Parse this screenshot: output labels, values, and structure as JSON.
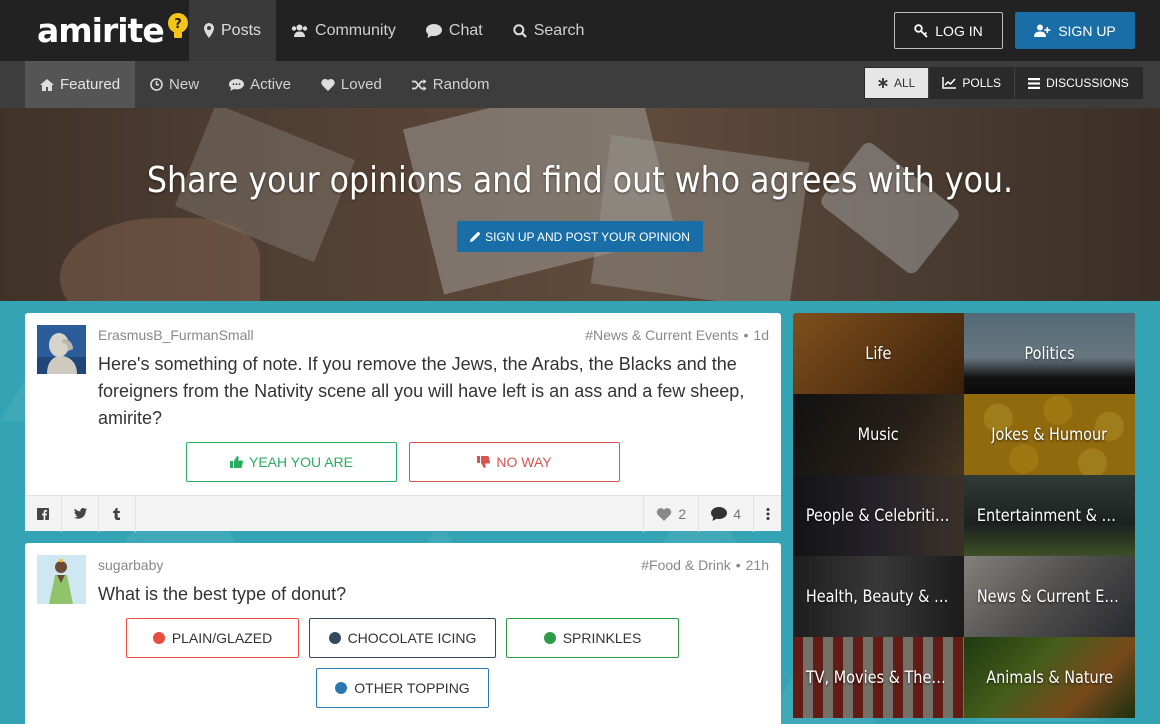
{
  "brand": {
    "name": "amirite"
  },
  "topnav": {
    "items": [
      {
        "label": "Posts",
        "icon": "map-marker-icon",
        "active": true
      },
      {
        "label": "Community",
        "icon": "users-icon"
      },
      {
        "label": "Chat",
        "icon": "comment-icon"
      },
      {
        "label": "Search",
        "icon": "search-icon"
      }
    ],
    "login_label": "LOG IN",
    "signup_label": "SIGN UP"
  },
  "subnav": {
    "items": [
      {
        "label": "Featured",
        "icon": "home-icon",
        "active": true
      },
      {
        "label": "New",
        "icon": "clock-icon"
      },
      {
        "label": "Active",
        "icon": "comments-icon"
      },
      {
        "label": "Loved",
        "icon": "heart-icon"
      },
      {
        "label": "Random",
        "icon": "shuffle-icon"
      }
    ],
    "filters": [
      {
        "label": "ALL",
        "icon": "asterisk-icon",
        "active": true
      },
      {
        "label": "POLLS",
        "icon": "chart-icon"
      },
      {
        "label": "DISCUSSIONS",
        "icon": "list-icon"
      }
    ]
  },
  "hero": {
    "title": "Share your opinions and find out who agrees with you.",
    "cta_label": "SIGN UP AND POST YOUR OPINION"
  },
  "posts": [
    {
      "username": "ErasmusB_FurmanSmall",
      "category": "#News & Current Events",
      "age": "1d",
      "text": "Here's something of note. If you remove the Jews, the Arabs, the Blacks and the foreigners from the Nativity scene all you will have left is an ass and a few sheep, amirite?",
      "yes_label": "YEAH YOU ARE",
      "no_label": "NO WAY",
      "likes": "2",
      "comments": "4"
    },
    {
      "username": "sugarbaby",
      "category": "#Food & Drink",
      "age": "21h",
      "text": "What is the best type of donut?",
      "options": [
        {
          "label": "PLAIN/GLAZED",
          "color": "#e74c3c"
        },
        {
          "label": "CHOCOLATE ICING",
          "color": "#34495e"
        },
        {
          "label": "SPRINKLES",
          "color": "#2e9b48"
        },
        {
          "label": "OTHER TOPPING",
          "color": "#2a7ab0"
        }
      ]
    }
  ],
  "categories": [
    {
      "label": "Life"
    },
    {
      "label": "Politics"
    },
    {
      "label": "Music"
    },
    {
      "label": "Jokes & Humour"
    },
    {
      "label": "People & Celebrities"
    },
    {
      "label": "Entertainment & H..."
    },
    {
      "label": "Health, Beauty & Fi..."
    },
    {
      "label": "News & Current Ev..."
    },
    {
      "label": "TV, Movies & Theatre"
    },
    {
      "label": "Animals & Nature"
    }
  ],
  "colors": {
    "accent": "#1a6ea8",
    "yes": "#27ae60",
    "no": "#d9534f",
    "page_bg": "#34a4b4"
  }
}
